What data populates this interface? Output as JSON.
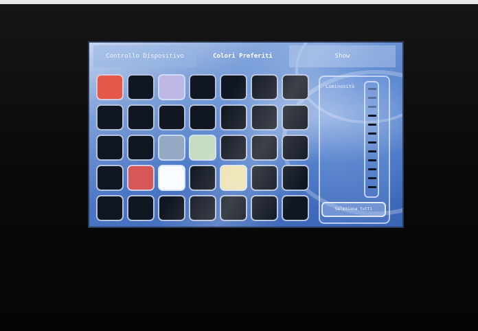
{
  "tabs": [
    {
      "label": "Controllo Dispositivo",
      "active": false
    },
    {
      "label": "Colori Preferiti",
      "active": true
    },
    {
      "label": "Show",
      "active": false
    }
  ],
  "color_grid": [
    [
      "#e5594a",
      "#111722",
      "#bdb8e6",
      "#111722",
      "#111722",
      "#111722",
      "#111722"
    ],
    [
      "#111722",
      "#111722",
      "#111722",
      "#111722",
      "#111722",
      "#111722",
      "#111722"
    ],
    [
      "#111722",
      "#111722",
      "#93aac2",
      "#c5dcc0",
      "#111722",
      "#111722",
      "#111722"
    ],
    [
      "#111722",
      "#d75656",
      "#f8fbff",
      "#111722",
      "#ede2b0",
      "#111722",
      "#111722"
    ],
    [
      "#111722",
      "#111722",
      "#111722",
      "#111722",
      "#111722",
      "#111722",
      "#111722"
    ]
  ],
  "side_panel": {
    "label": "Luminosità",
    "slider_level": 0.75,
    "button_label": "Seleziona tutti"
  },
  "colors": {
    "screen_bg": "#4a76c4",
    "cell_empty": "#111722",
    "bezel": "#0a0a0a"
  }
}
